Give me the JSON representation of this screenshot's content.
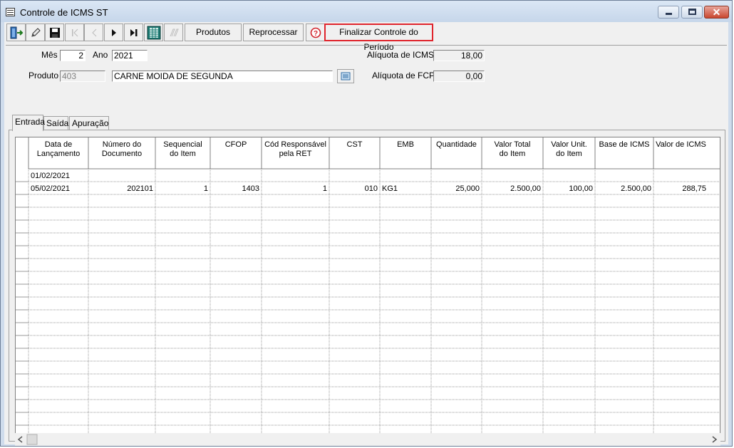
{
  "window": {
    "title": "Controle de ICMS ST"
  },
  "toolbar": {
    "produtos_label": "Produtos",
    "reprocessar_label": "Reprocessar",
    "finalizar_label": "Finalizar Controle do Período"
  },
  "form": {
    "mes_label": "Mês",
    "mes_value": "2",
    "ano_label": "Ano",
    "ano_value": "2021",
    "produto_label": "Produto",
    "produto_code": "403",
    "produto_name": "CARNE MOIDA DE SEGUNDA",
    "aliquota_icms_label": "Alíquota de ICMS",
    "aliquota_icms_value": "18,00",
    "aliquota_fcp_label": "Alíquota de FCP",
    "aliquota_fcp_value": "0,00"
  },
  "tabs": [
    {
      "label": "Entrada",
      "active": true
    },
    {
      "label": "Saída",
      "active": false
    },
    {
      "label": "Apuração",
      "active": false
    }
  ],
  "grid": {
    "columns": [
      [
        "Data de",
        "Lançamento"
      ],
      [
        "Número do",
        "Documento"
      ],
      [
        "Sequencial",
        "do Item"
      ],
      [
        "CFOP",
        ""
      ],
      [
        "Cód Responsável",
        "pela RET"
      ],
      [
        "CST",
        ""
      ],
      [
        "EMB",
        ""
      ],
      [
        "Quantidade",
        ""
      ],
      [
        "Valor Total",
        "do Item"
      ],
      [
        "Valor Unit.",
        "do Item"
      ],
      [
        "Base de ICMS",
        ""
      ],
      [
        "Valor de ICMS",
        ""
      ]
    ],
    "rows": [
      [
        "01/02/2021",
        "",
        "",
        "",
        "",
        "",
        "",
        "",
        "",
        "",
        "",
        ""
      ],
      [
        "05/02/2021",
        "202101",
        "1",
        "1403",
        "1",
        "010",
        "KG1",
        "25,000",
        "2.500,00",
        "100,00",
        "2.500,00",
        "288,75"
      ]
    ]
  },
  "colors": {
    "highlight_border": "#e0242c",
    "titlebar": "#c6d6ea"
  }
}
